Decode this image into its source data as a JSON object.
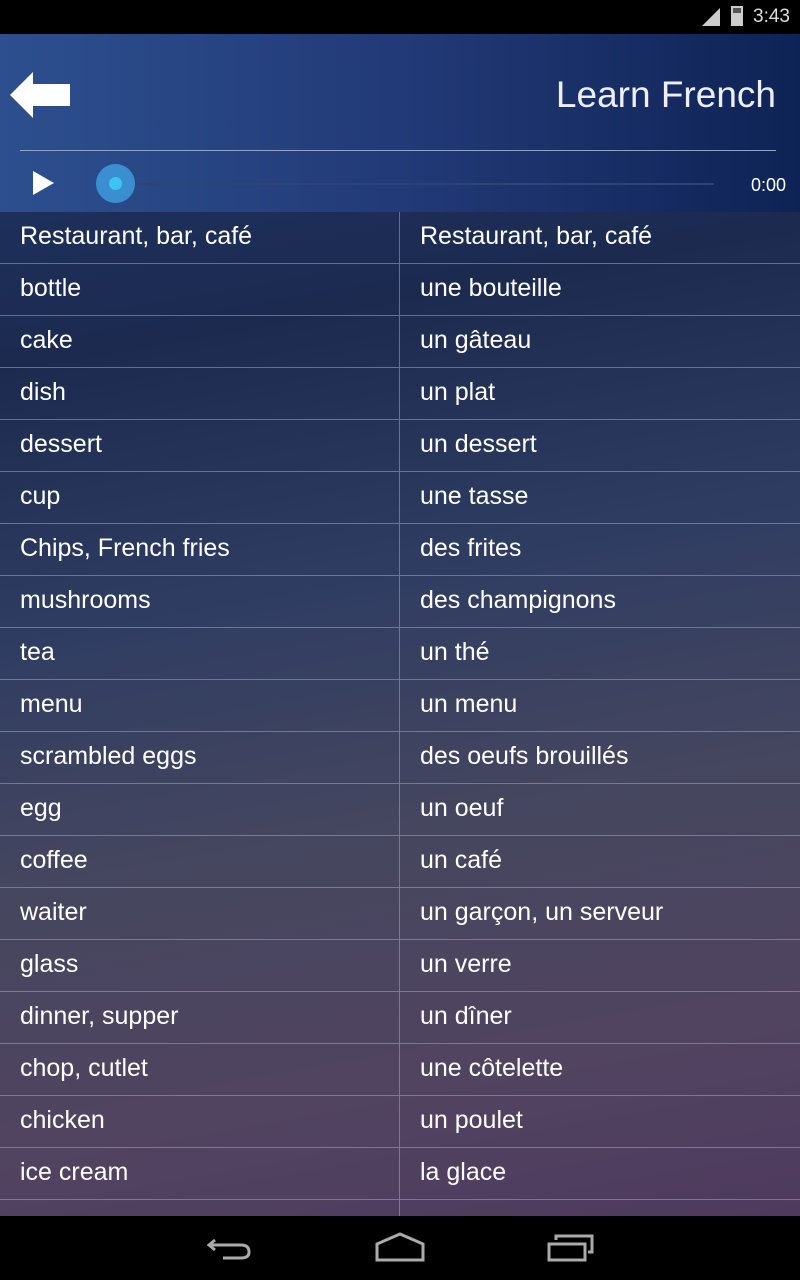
{
  "status_bar": {
    "time": "3:43",
    "network": "3G",
    "icons": [
      "signal-icon",
      "battery-icon"
    ]
  },
  "header": {
    "title": "Learn French",
    "back_icon": "arrow-left-icon"
  },
  "player": {
    "time": "0:00",
    "progress": 0,
    "play_icon": "play-icon"
  },
  "rows": [
    [
      "Restaurant, bar, café",
      "Restaurant, bar, café"
    ],
    [
      "bottle",
      "une bouteille"
    ],
    [
      "cake",
      "un gâteau"
    ],
    [
      "dish",
      "un plat"
    ],
    [
      "dessert",
      "un dessert"
    ],
    [
      "cup",
      "une tasse"
    ],
    [
      "Chips, French fries",
      "des frites"
    ],
    [
      "mushrooms",
      "des champignons"
    ],
    [
      "tea",
      "un thé"
    ],
    [
      "menu",
      "un menu"
    ],
    [
      "scrambled eggs",
      "des oeufs brouillés"
    ],
    [
      "egg",
      "un oeuf"
    ],
    [
      "coffee",
      "un café"
    ],
    [
      "waiter",
      "un garçon, un serveur"
    ],
    [
      "glass",
      "un verre"
    ],
    [
      "dinner, supper",
      "un dîner"
    ],
    [
      "chop, cutlet",
      "une côtelette"
    ],
    [
      "chicken",
      "un poulet"
    ],
    [
      "ice cream",
      "la glace"
    ]
  ]
}
